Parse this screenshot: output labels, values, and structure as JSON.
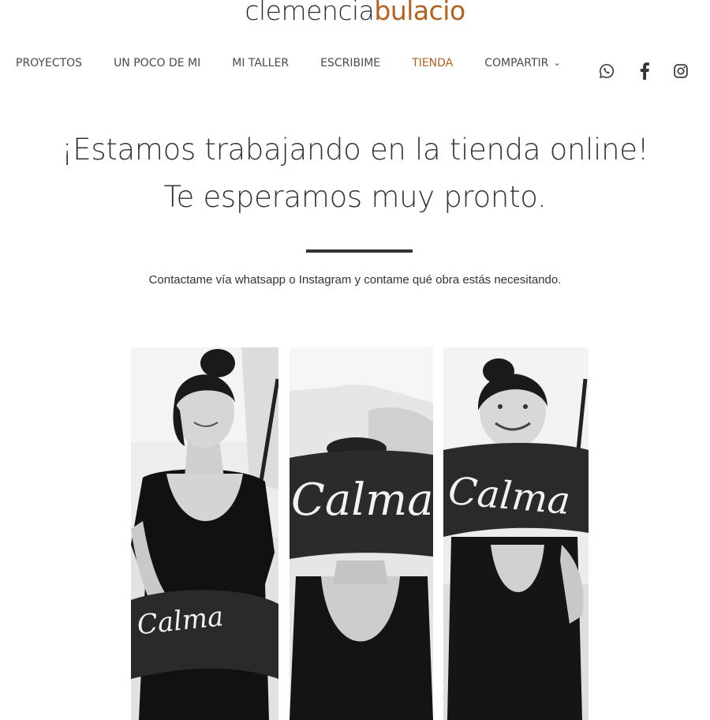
{
  "brand": {
    "first": "clemencia",
    "second": "bulacio",
    "accent_color": "#b4611e"
  },
  "nav": {
    "items": [
      {
        "label": "PROYECTOS"
      },
      {
        "label": "UN POCO DE MI"
      },
      {
        "label": "MI TALLER"
      },
      {
        "label": "ESCRIBIME"
      },
      {
        "label": "TIENDA",
        "active": true
      },
      {
        "label": "COMPARTIR",
        "has_dropdown": true
      }
    ]
  },
  "social": {
    "icons": [
      "whatsapp-icon",
      "facebook-icon",
      "instagram-icon"
    ]
  },
  "main": {
    "headline_line1": "¡Estamos trabajando en la tienda online!",
    "headline_line2": "Te esperamos muy pronto.",
    "subtext": "Contactame vía whatsapp o Instagram y contame qué obra estás necesitando."
  },
  "gallery": {
    "photos": [
      {
        "pillow_text": "Calma"
      },
      {
        "pillow_text": "Calma"
      },
      {
        "pillow_text": "Calma"
      }
    ]
  }
}
